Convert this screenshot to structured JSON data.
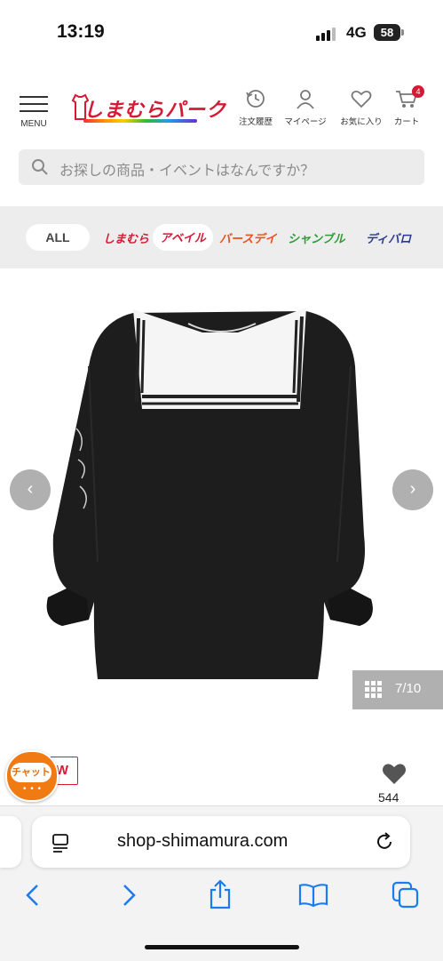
{
  "status": {
    "time": "13:19",
    "network": "4G",
    "battery": "58"
  },
  "header": {
    "menu_label": "MENU",
    "logo_text": "しまむらパーク",
    "icons": [
      {
        "label": "注文履歴",
        "icon": "history-icon"
      },
      {
        "label": "マイページ",
        "icon": "person-icon"
      },
      {
        "label": "お気に入り",
        "icon": "heart-icon"
      },
      {
        "label": "カート",
        "icon": "cart-icon"
      }
    ],
    "cart_count": "4"
  },
  "search": {
    "placeholder": "お探しの商品・イベントはなんですか？"
  },
  "brands": {
    "all": "ALL",
    "items": [
      {
        "label": "しまむら",
        "color": "#d51a35"
      },
      {
        "label": "アベイル",
        "color": "#d51a35"
      },
      {
        "label": "バースデイ",
        "color": "#e8501c"
      },
      {
        "label": "シャンブル",
        "color": "#2f9b3a"
      },
      {
        "label": "ディバロ",
        "color": "#2b3a8f"
      }
    ]
  },
  "product": {
    "image_counter": "7/10",
    "prev": "‹",
    "next": "›",
    "badge": "W",
    "like_count": "544",
    "chat_label": "チャット",
    "chat_dots": "• • •"
  },
  "browser": {
    "url": "shop-shimamura.com"
  }
}
